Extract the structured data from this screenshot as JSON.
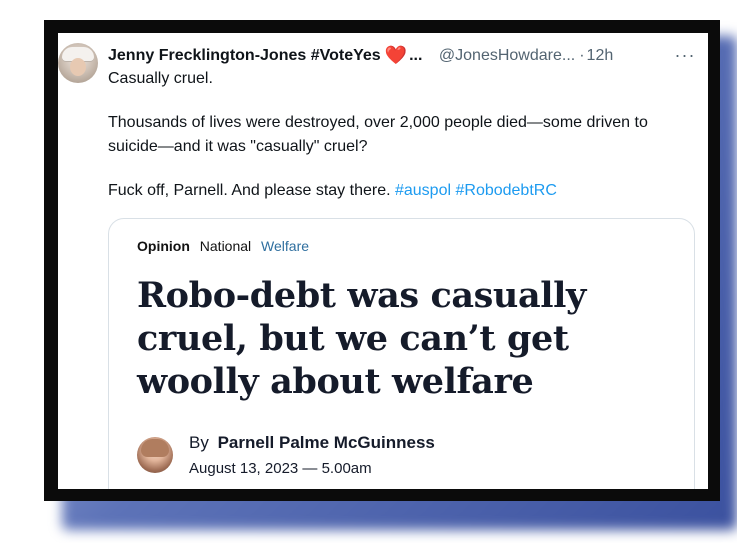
{
  "tweet": {
    "author_name": "Jenny Frecklington-Jones #VoteYes",
    "heart_emoji": "❤️",
    "name_ellipsis": "...",
    "handle": "@JonesHowdare...",
    "separator": "·",
    "time": "12h",
    "more_icon": "···",
    "lines": [
      "Casually cruel.",
      "Thousands of lives were destroyed, over 2,000 people died—some driven to suicide—and it was \"casually\" cruel?"
    ],
    "last_line_text": "Fuck off, Parnell. And please stay there.",
    "hashtags": [
      "#auspol",
      "#RobodebtRC"
    ]
  },
  "card": {
    "section_opinion": "Opinion",
    "section_national": "National",
    "section_welfare": "Welfare",
    "headline": "Robo-debt was casually cruel, but we can’t get woolly about welfare",
    "by": "By",
    "author": "Parnell Palme McGuinness",
    "date": "August 13, 2023 — 5.00am"
  },
  "colors": {
    "link": "#1d9bf0",
    "frame": "#0b0b0b",
    "shadow": "#3b519f",
    "heart": "#e0245e"
  }
}
